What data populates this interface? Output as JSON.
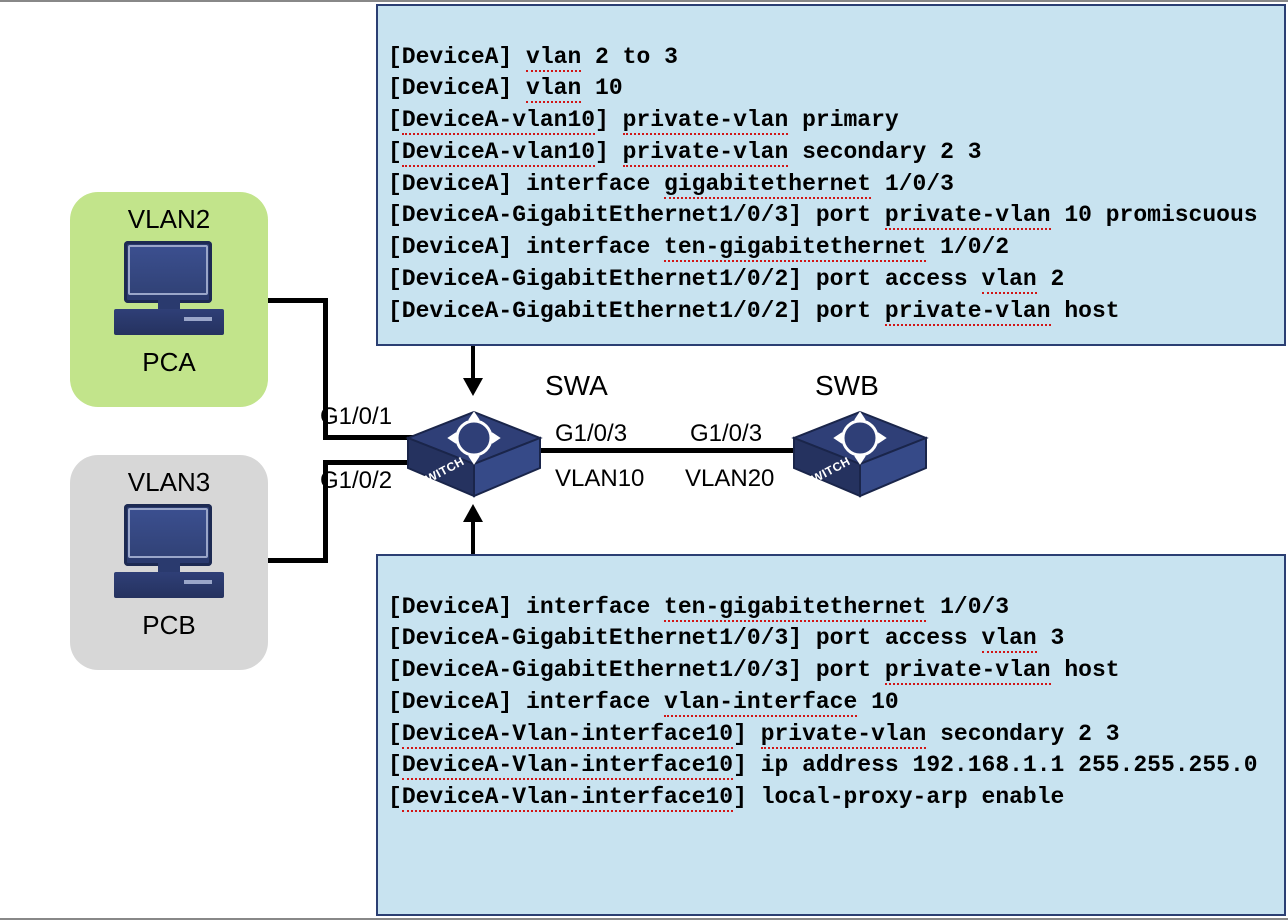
{
  "hosts": {
    "a": {
      "vlan": "VLAN2",
      "name": "PCA"
    },
    "b": {
      "vlan": "VLAN3",
      "name": "PCB"
    }
  },
  "switches": {
    "swa": {
      "label": "SWA",
      "side": "SWITCH"
    },
    "swb": {
      "label": "SWB",
      "side": "SWITCH"
    }
  },
  "ports": {
    "swa_g101": "G1/0/1",
    "swa_g102": "G1/0/2",
    "swa_g103": "G1/0/3",
    "swb_g103": "G1/0/3",
    "vlan10": "VLAN10",
    "vlan20": "VLAN20"
  },
  "config_top": {
    "l1": {
      "pre": "[DeviceA] ",
      "u1": "vlan",
      "post": " 2 to 3"
    },
    "l2": {
      "pre": "[DeviceA] ",
      "u1": "vlan",
      "post": " 10"
    },
    "l3": {
      "pre": "[",
      "u1": "DeviceA-vlan10",
      "mid": "] ",
      "u2": "private-vlan",
      "post": " primary"
    },
    "l4": {
      "pre": "[",
      "u1": "DeviceA-vlan10",
      "mid": "] ",
      "u2": "private-vlan",
      "post": " secondary 2 3"
    },
    "l5": {
      "pre": "[DeviceA] interface ",
      "u1": "gigabitethernet",
      "post": " 1/0/3"
    },
    "l6": {
      "pre": "[DeviceA-GigabitEthernet1/0/3] port ",
      "u1": "private-vlan",
      "post": " 10 promiscuous"
    },
    "l7": {
      "pre": "[DeviceA] interface ",
      "u1": "ten-gigabitethernet",
      "post": " 1/0/2"
    },
    "l8": {
      "pre": "[DeviceA-GigabitEthernet1/0/2] port access ",
      "u1": "vlan",
      "post": " 2"
    },
    "l9": {
      "pre": "[DeviceA-GigabitEthernet1/0/2] port ",
      "u1": "private-vlan",
      "post": " host"
    }
  },
  "config_bottom": {
    "l1": {
      "pre": "[DeviceA] interface ",
      "u1": "ten-gigabitethernet",
      "post": " 1/0/3"
    },
    "l2": {
      "pre": "[DeviceA-GigabitEthernet1/0/3] port access ",
      "u1": "vlan",
      "post": " 3"
    },
    "l3": {
      "pre": "[DeviceA-GigabitEthernet1/0/3] port ",
      "u1": "private-vlan",
      "post": " host"
    },
    "l4": {
      "pre": "[DeviceA] interface ",
      "u1": "vlan-interface",
      "post": " 10"
    },
    "l5": {
      "pre": "[",
      "u1": "DeviceA-Vlan-interface10",
      "mid": "] ",
      "u2": "private-vlan",
      "post": " secondary 2 3"
    },
    "l6": {
      "pre": "[",
      "u1": "DeviceA-Vlan-interface10",
      "mid": "] ",
      "post": "ip address 192.168.1.1 255.255.255.0"
    },
    "l7": {
      "pre": "[",
      "u1": "DeviceA-Vlan-interface10",
      "mid": "] ",
      "post": "local-proxy-arp enable"
    }
  }
}
